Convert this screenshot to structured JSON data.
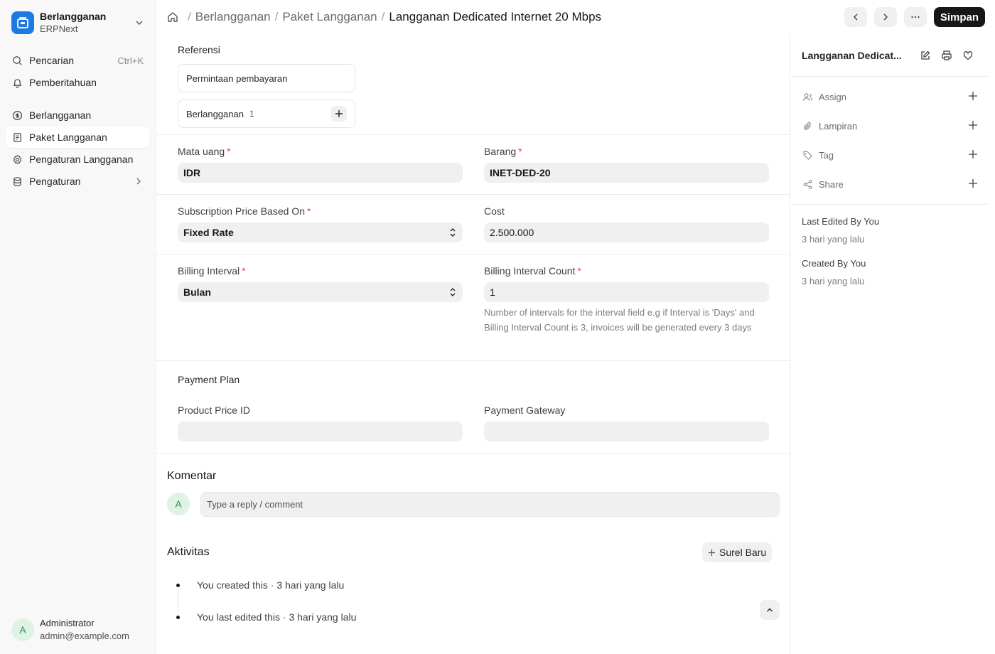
{
  "sidebar": {
    "app_title": "Berlangganan",
    "app_subtitle": "ERPNext",
    "search_label": "Pencarian",
    "search_shortcut": "Ctrl+K",
    "notifications_label": "Pemberitahuan",
    "items": [
      {
        "label": "Berlangganan",
        "icon": "dollar-circle-icon"
      },
      {
        "label": "Paket Langganan",
        "icon": "document-icon",
        "active": true
      },
      {
        "label": "Pengaturan Langganan",
        "icon": "gear-icon"
      },
      {
        "label": "Pengaturan",
        "icon": "database-icon"
      }
    ],
    "user": {
      "initial": "A",
      "name": "Administrator",
      "email": "admin@example.com"
    }
  },
  "header": {
    "breadcrumbs": [
      "Berlangganan",
      "Paket Langganan"
    ],
    "current": "Langganan Dedicated Internet 20 Mbps",
    "save_label": "Simpan"
  },
  "form": {
    "references_title": "Referensi",
    "references": [
      {
        "label": "Permintaan pembayaran"
      },
      {
        "label": "Berlangganan",
        "count": "1"
      }
    ],
    "currency": {
      "label": "Mata uang",
      "value": "IDR"
    },
    "item": {
      "label": "Barang",
      "value": "INET-DED-20"
    },
    "price_based_on": {
      "label": "Subscription Price Based On",
      "value": "Fixed Rate"
    },
    "cost": {
      "label": "Cost",
      "value": "2.500.000"
    },
    "billing_interval": {
      "label": "Billing Interval",
      "value": "Bulan"
    },
    "billing_interval_count": {
      "label": "Billing Interval Count",
      "value": "1",
      "help": "Number of intervals for the interval field e.g if Interval is 'Days' and Billing Interval Count is 3, invoices will be generated every 3 days"
    },
    "payment_plan_title": "Payment Plan",
    "product_price_id": {
      "label": "Product Price ID",
      "value": ""
    },
    "payment_gateway": {
      "label": "Payment Gateway",
      "value": ""
    }
  },
  "comments": {
    "title": "Komentar",
    "avatar_initial": "A",
    "placeholder": "Type a reply / comment"
  },
  "activity": {
    "title": "Aktivitas",
    "new_email_label": "Surel Baru",
    "items": [
      "You created this · 3 hari yang lalu",
      "You last edited this · 3 hari yang lalu"
    ]
  },
  "right_panel": {
    "title": "Langganan Dedicat...",
    "actions": [
      "Assign",
      "Lampiran",
      "Tag",
      "Share"
    ],
    "last_edited_label": "Last Edited By You",
    "last_edited_time": "3 hari yang lalu",
    "created_label": "Created By You",
    "created_time": "3 hari yang lalu"
  },
  "colors": {
    "brand": "#1f7ae0",
    "primary_button": "#171717",
    "required": "#e5484d"
  }
}
